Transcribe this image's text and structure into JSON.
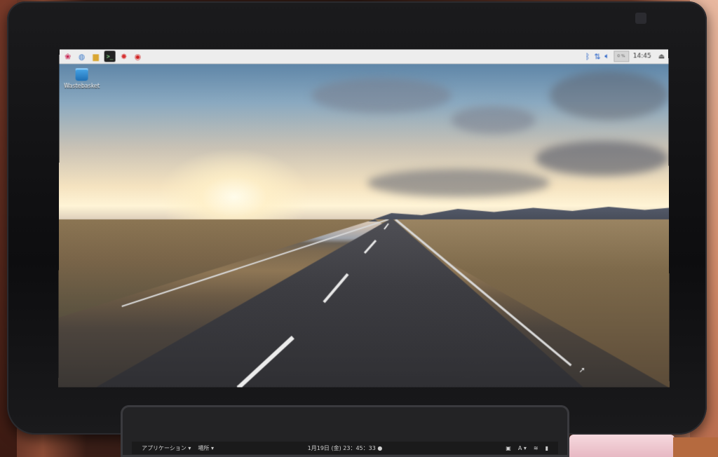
{
  "menu_panel": {
    "launchers": [
      {
        "icon": "raspberry-menu-icon",
        "glyph": "❀"
      },
      {
        "icon": "web-browser-icon",
        "glyph": "◍"
      },
      {
        "icon": "file-manager-icon",
        "glyph": "▆"
      },
      {
        "icon": "terminal-icon",
        "glyph": ">_"
      },
      {
        "icon": "mathematica-icon",
        "glyph": "✸"
      },
      {
        "icon": "wolfram-icon",
        "glyph": "◉"
      }
    ],
    "tray": {
      "bluetooth_icon": "bluetooth-icon",
      "network_icon": "network-icon",
      "volume_icon": "volume-icon",
      "cpu_label": "0 %",
      "clock": "14:45",
      "eject_icon": "eject-icon"
    }
  },
  "desktop": {
    "icons": [
      {
        "label": "Wastebasket",
        "icon": "trash-icon"
      }
    ]
  },
  "laptop_topbar": {
    "applications": "アプリケーション ▾",
    "places": "場所 ▾",
    "datetime": "1月19日 (金) 23：45：33 ●",
    "input_method": "A ▾"
  }
}
